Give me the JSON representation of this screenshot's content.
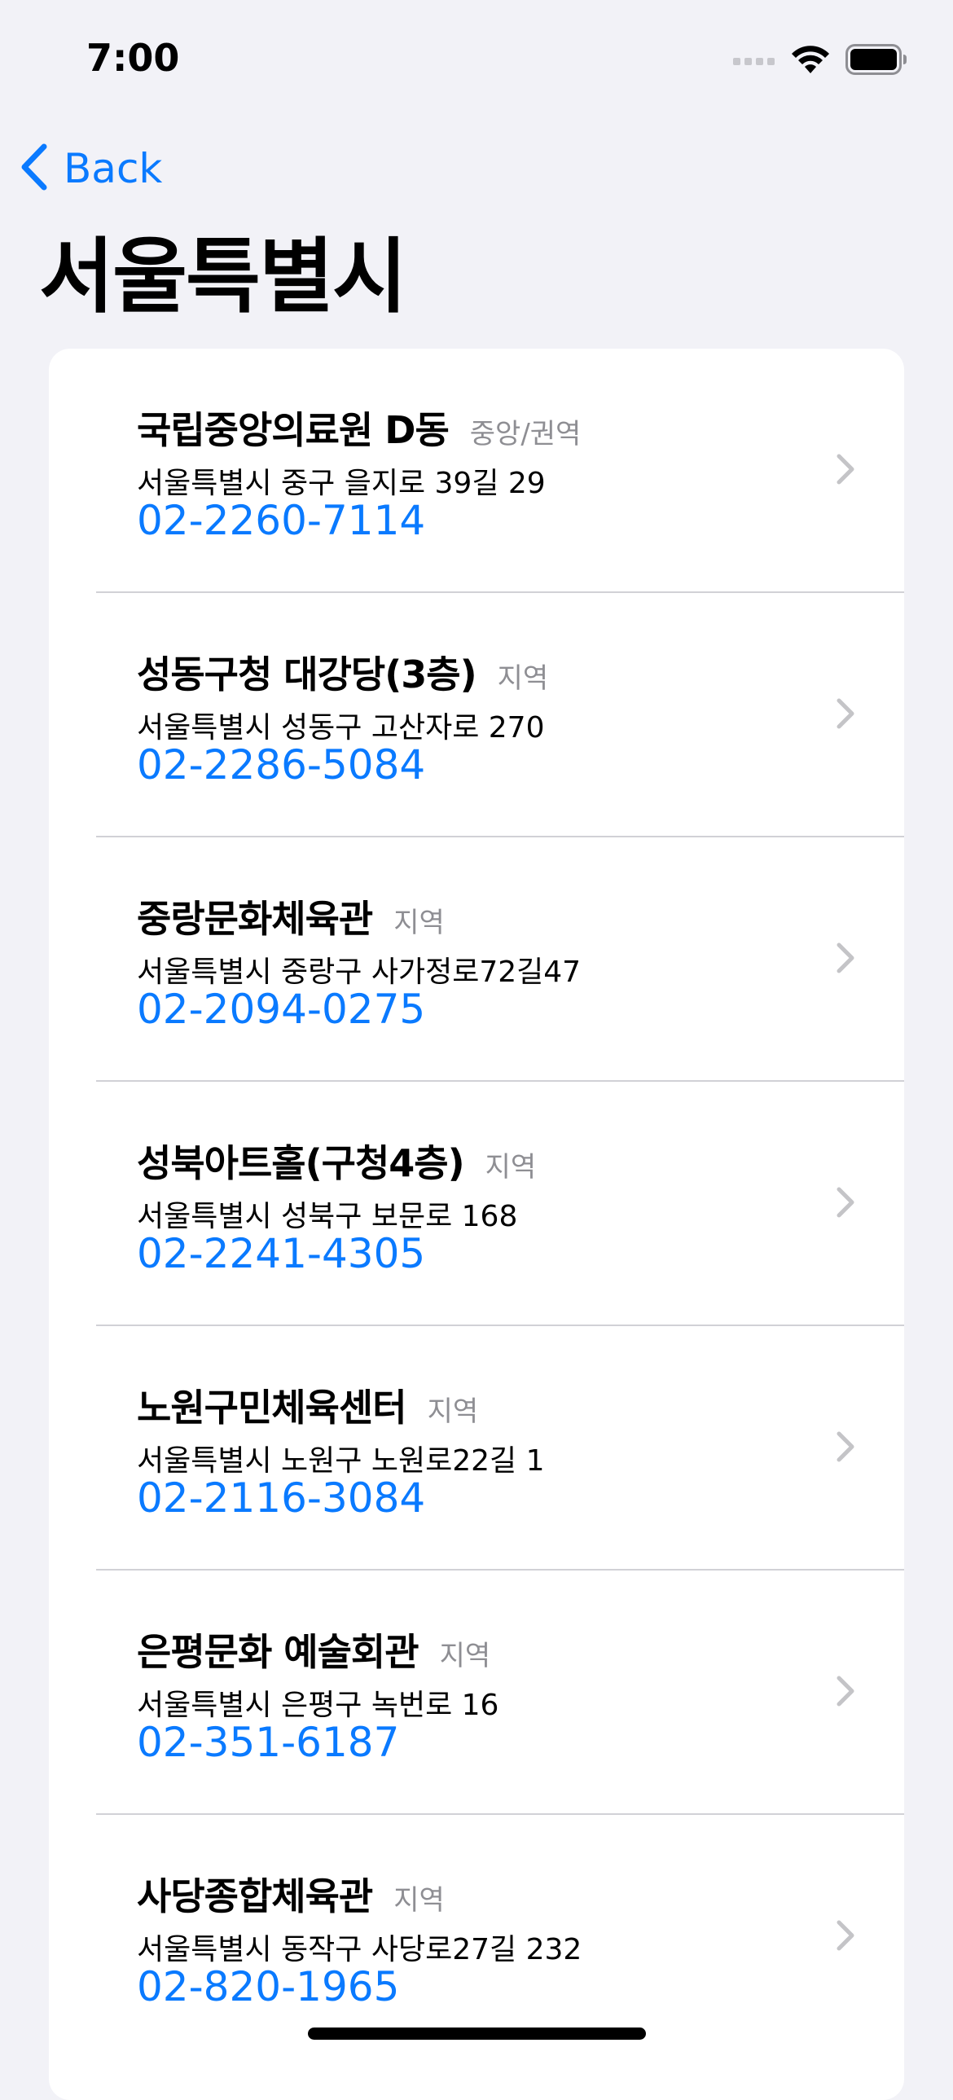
{
  "status_bar": {
    "time": "7:00"
  },
  "nav": {
    "back_label": "Back"
  },
  "page": {
    "title": "서울특별시"
  },
  "items": [
    {
      "name": "국립중앙의료원 D동",
      "type": "중앙/권역",
      "address": "서울특별시 중구 을지로 39길 29",
      "phone": "02-2260-7114"
    },
    {
      "name": "성동구청 대강당(3층)",
      "type": "지역",
      "address": "서울특별시 성동구 고산자로 270",
      "phone": "02-2286-5084"
    },
    {
      "name": "중랑문화체육관",
      "type": "지역",
      "address": "서울특별시 중랑구 사가정로72길47",
      "phone": "02-2094-0275"
    },
    {
      "name": "성북아트홀(구청4층)",
      "type": "지역",
      "address": "서울특별시 성북구 보문로 168",
      "phone": "02-2241-4305"
    },
    {
      "name": "노원구민체육센터",
      "type": "지역",
      "address": "서울특별시 노원구 노원로22길 1",
      "phone": "02-2116-3084"
    },
    {
      "name": "은평문화 예술회관",
      "type": "지역",
      "address": "서울특별시 은평구 녹번로 16",
      "phone": "02-351-6187"
    },
    {
      "name": "사당종합체육관",
      "type": "지역",
      "address": "서울특별시 동작구 사당로27길 232",
      "phone": "02-820-1965"
    }
  ],
  "colors": {
    "accent": "#0a7aff",
    "background": "#f2f2f7",
    "secondary_text": "#8e8e93",
    "chevron": "#c4c4c7"
  },
  "icons": {
    "back": "chevron-left-icon",
    "row": "chevron-right-icon",
    "signal": "cellular-signal-icon",
    "wifi": "wifi-icon",
    "battery": "battery-icon"
  }
}
